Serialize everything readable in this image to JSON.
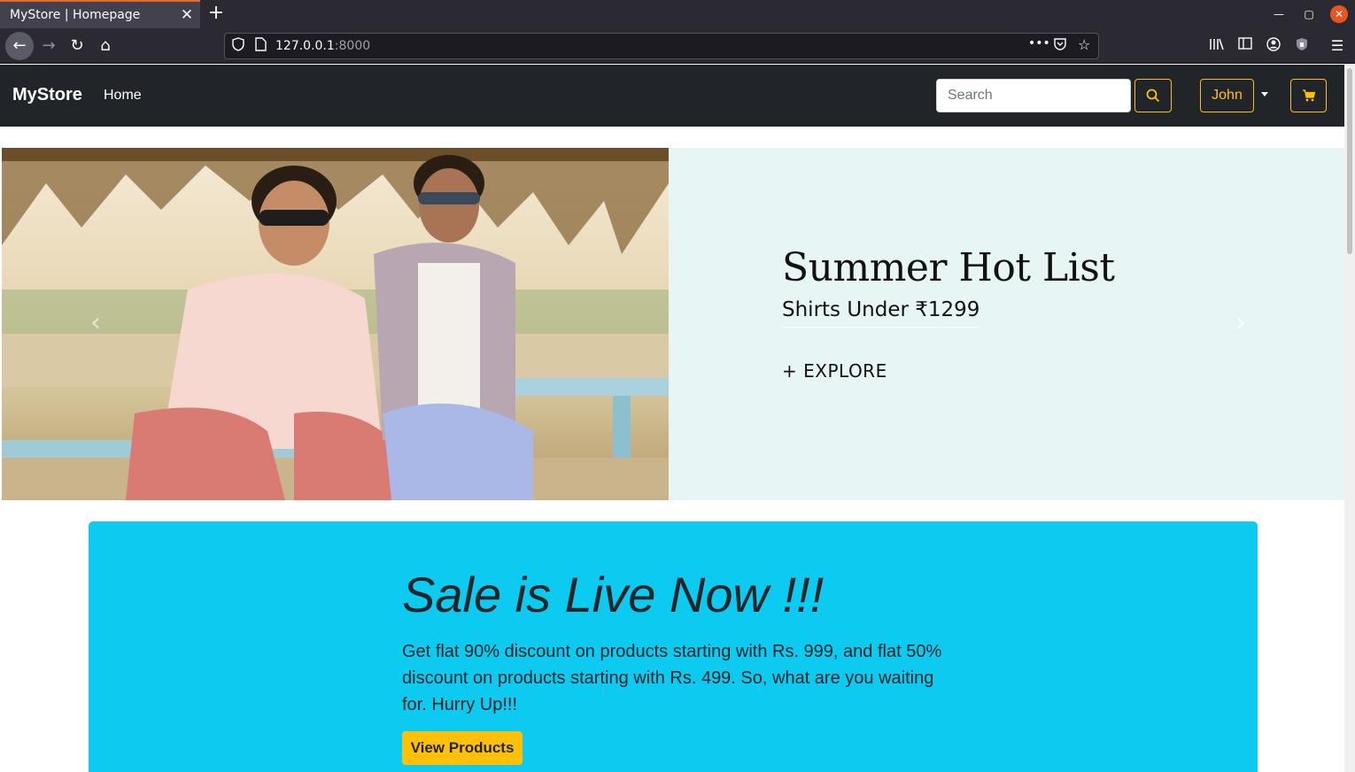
{
  "browser": {
    "tab_title": "MyStore | Homepage",
    "url_host": "127.0.0.1",
    "url_port": ":8000",
    "accent": "#e66a2c"
  },
  "site_nav": {
    "brand": "MyStore",
    "links": [
      "Home"
    ],
    "search_placeholder": "Search",
    "user_label": "John",
    "button_color": "#ffc107"
  },
  "carousel": {
    "title": "Summer Hot List",
    "subtitle": "Shirts Under ₹1299",
    "cta": "+ EXPLORE",
    "background": "#e8f5f5"
  },
  "jumbotron": {
    "title": "Sale is Live Now !!!",
    "text": "Get flat 90% discount on products starting with Rs. 999, and flat 50% discount on products starting with Rs. 499. So, what are you waiting for. Hurry Up!!!",
    "button_label": "View Products",
    "background": "#0dcaf0"
  }
}
